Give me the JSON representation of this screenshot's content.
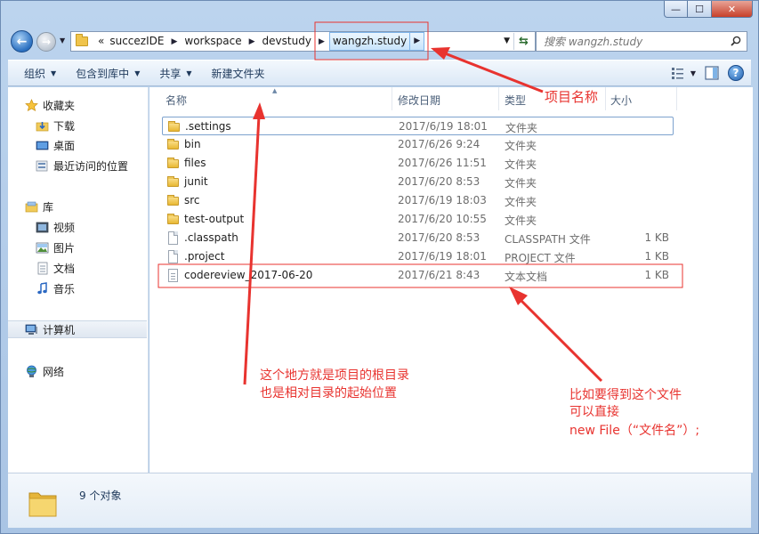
{
  "window": {
    "caption_min": "—",
    "caption_max": "☐",
    "caption_close": "✕"
  },
  "nav": {
    "back_label": "←",
    "forward_label": "→",
    "overflow": "«",
    "breadcrumbs": [
      "succezIDE",
      "workspace",
      "devstudy",
      "wangzh.study"
    ],
    "search_placeholder": "搜索 wangzh.study"
  },
  "toolbar": {
    "items": [
      {
        "label": "组织",
        "has_dropdown": true
      },
      {
        "label": "包含到库中",
        "has_dropdown": true
      },
      {
        "label": "共享",
        "has_dropdown": true
      },
      {
        "label": "新建文件夹",
        "has_dropdown": false
      }
    ],
    "help_label": "?"
  },
  "sidebar": {
    "favorites": {
      "label": "收藏夹",
      "items": [
        "下载",
        "桌面",
        "最近访问的位置"
      ]
    },
    "libraries": {
      "label": "库",
      "items": [
        "视频",
        "图片",
        "文档",
        "音乐"
      ]
    },
    "computer": {
      "label": "计算机"
    },
    "network": {
      "label": "网络"
    }
  },
  "columns": {
    "name": "名称",
    "date": "修改日期",
    "type": "类型",
    "size": "大小"
  },
  "files": [
    {
      "name": ".settings",
      "date": "2017/6/19 18:01",
      "type": "文件夹",
      "size": "",
      "icon": "folder"
    },
    {
      "name": "bin",
      "date": "2017/6/26 9:24",
      "type": "文件夹",
      "size": "",
      "icon": "folder"
    },
    {
      "name": "files",
      "date": "2017/6/26 11:51",
      "type": "文件夹",
      "size": "",
      "icon": "folder"
    },
    {
      "name": "junit",
      "date": "2017/6/20 8:53",
      "type": "文件夹",
      "size": "",
      "icon": "folder"
    },
    {
      "name": "src",
      "date": "2017/6/19 18:03",
      "type": "文件夹",
      "size": "",
      "icon": "folder"
    },
    {
      "name": "test-output",
      "date": "2017/6/20 10:55",
      "type": "文件夹",
      "size": "",
      "icon": "folder"
    },
    {
      "name": ".classpath",
      "date": "2017/6/20 8:53",
      "type": "CLASSPATH 文件",
      "size": "1 KB",
      "icon": "file"
    },
    {
      "name": ".project",
      "date": "2017/6/19 18:01",
      "type": "PROJECT 文件",
      "size": "1 KB",
      "icon": "file"
    },
    {
      "name": "codereview_2017-06-20",
      "date": "2017/6/21 8:43",
      "type": "文本文档",
      "size": "1 KB",
      "icon": "text-file"
    }
  ],
  "details": {
    "count_text": "9 个对象"
  },
  "annotations": {
    "project_name": "项目名称",
    "root_line1": "这个地方就是项目的根目录",
    "root_line2": "也是相对目录的起始位置",
    "file_line1": "比如要得到这个文件",
    "file_line2": "可以直接",
    "file_line3": "new File（“文件名”）;",
    "color": "#e8332f"
  }
}
